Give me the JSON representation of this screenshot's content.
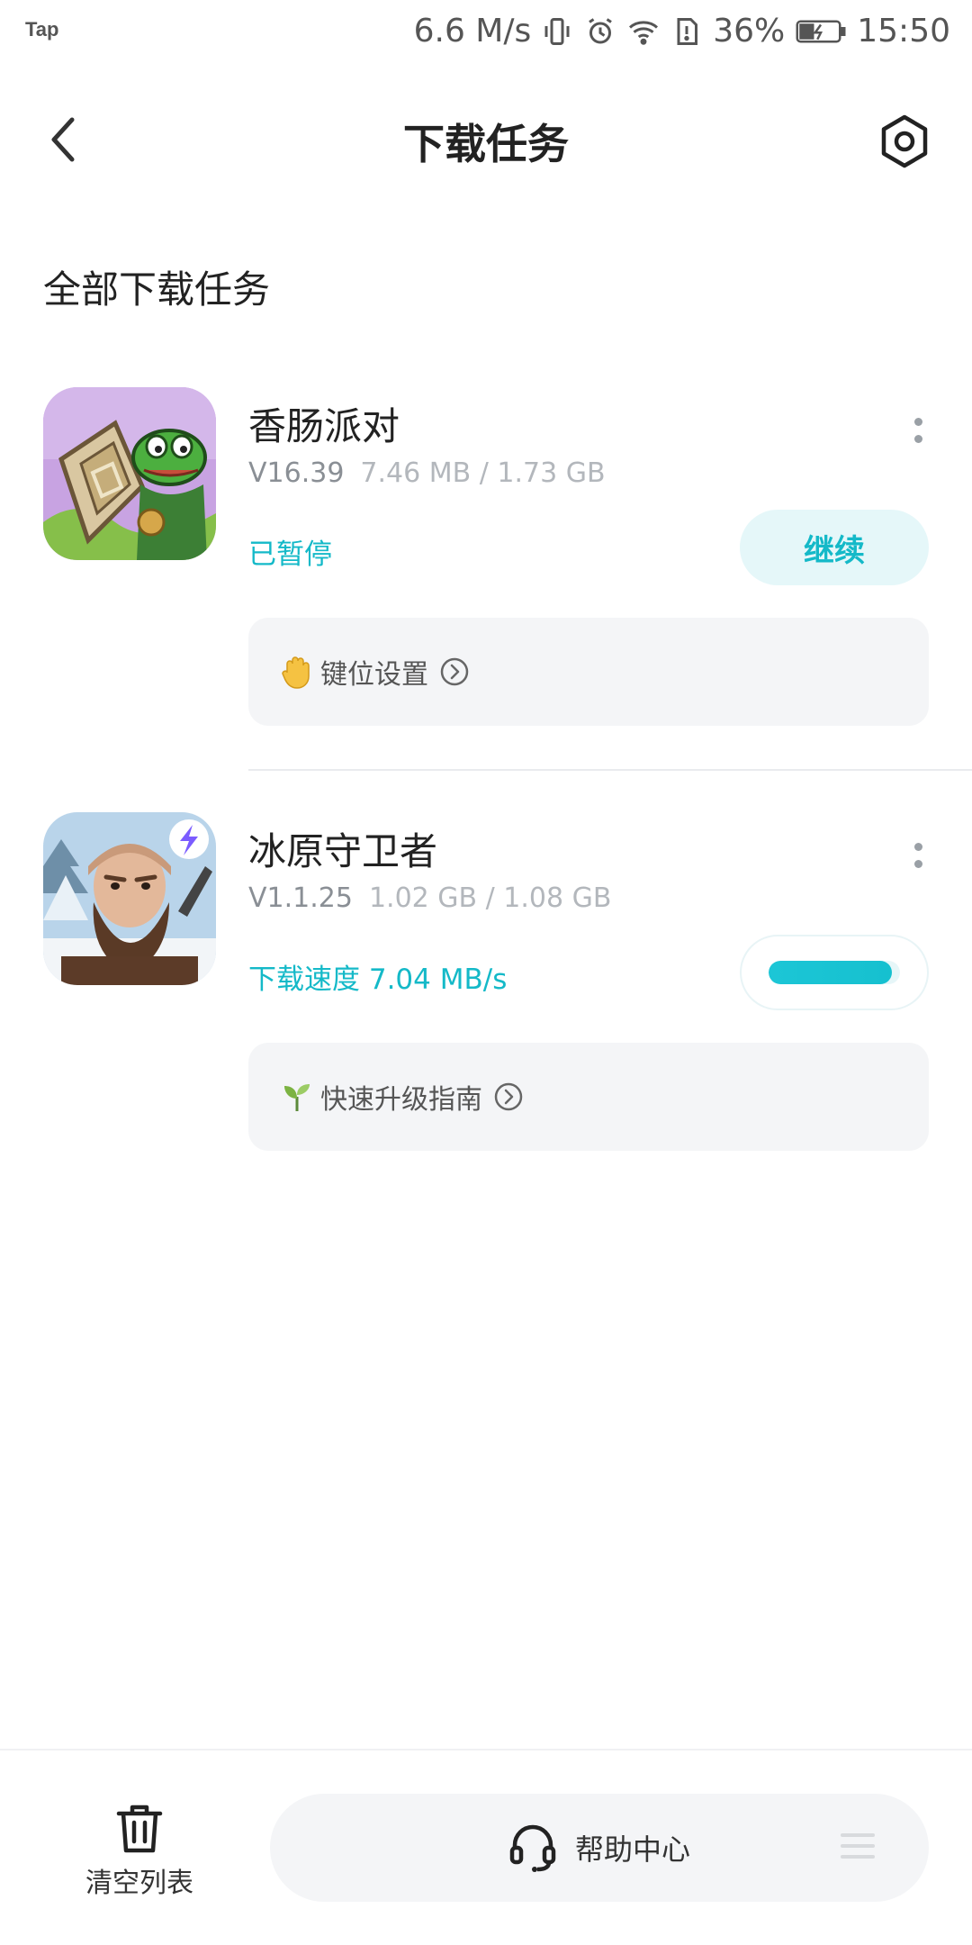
{
  "status_bar": {
    "carrier": "Tap",
    "net_speed": "6.6 M/s",
    "battery": "36%",
    "time": "15:50"
  },
  "header": {
    "title": "下载任务"
  },
  "section_title": "全部下载任务",
  "tasks": [
    {
      "name": "香肠派对",
      "version": "V16.39",
      "size": "7.46 MB / 1.73 GB",
      "status": "已暂停",
      "action_label": "继续",
      "tip": "键位设置",
      "tip_icon": "hand-emoji-icon"
    },
    {
      "name": "冰原守卫者",
      "version": "V1.1.25",
      "size": "1.02 GB / 1.08 GB",
      "status": "下载速度 7.04 MB/s",
      "progress": 0.94,
      "tip": "快速升级指南",
      "tip_icon": "sprout-emoji-icon"
    }
  ],
  "bottom_bar": {
    "clear_label": "清空列表",
    "help_label": "帮助中心"
  },
  "colors": {
    "accent": "#14b9c8",
    "accent_light": "#e5f7f9",
    "tip_bg": "#f4f5f7"
  }
}
